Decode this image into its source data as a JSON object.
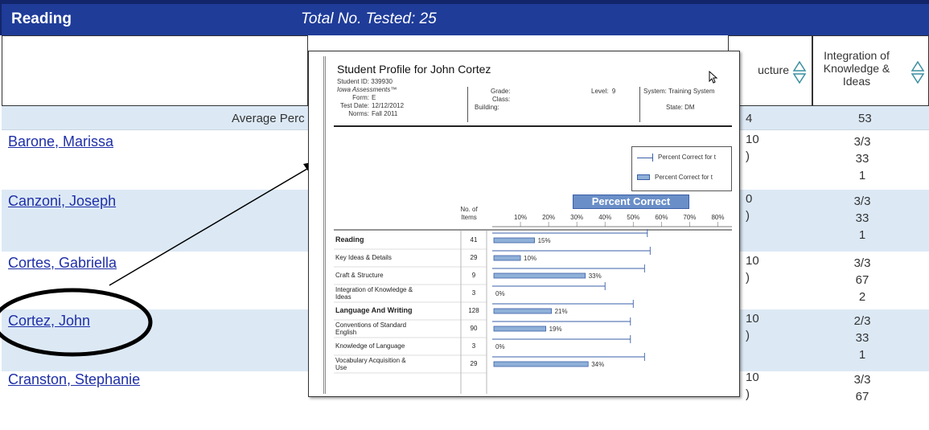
{
  "header": {
    "title": "Reading",
    "total_tested": "Total No. Tested: 25"
  },
  "columns": {
    "structure_fragment": "ucture",
    "integration": "Integration of Knowledge & Ideas"
  },
  "average_row": {
    "label": "Average Perc",
    "c3": "4",
    "c4": "53"
  },
  "students": [
    {
      "name": "Barone, Marissa",
      "frag1": "10",
      "frag2": ")",
      "c4": [
        "3/3",
        "33",
        "1"
      ]
    },
    {
      "name": "Canzoni, Joseph",
      "frag1": "0",
      "frag2": ")",
      "c4": [
        "3/3",
        "33",
        "1"
      ]
    },
    {
      "name": "Cortes, Gabriella",
      "frag1": "10",
      "frag2": ")",
      "c4": [
        "3/3",
        "67",
        "2"
      ]
    },
    {
      "name": "Cortez, John",
      "frag1": "10",
      "frag2": ")",
      "c4": [
        "2/3",
        "33",
        "1"
      ]
    },
    {
      "name": "Cranston, Stephanie",
      "frag1": "10",
      "frag2": ")",
      "c4": [
        "3/3",
        "67"
      ]
    }
  ],
  "popup": {
    "title": "Student Profile for John Cortez",
    "student_id_label": "Student ID:",
    "student_id": "339930",
    "assessment": "Iowa Assessments™",
    "form_label": "Form:",
    "form": "E",
    "test_date_label": "Test Date:",
    "test_date": "12/12/2012",
    "norms_label": "Norms:",
    "norms": "Fall 2011",
    "grade_label": "Grade:",
    "class_label": "Class:",
    "building_label": "Building:",
    "level_label": "Level:",
    "level": "9",
    "system_label": "System:",
    "system": "Training System",
    "state_label": "State:",
    "state": "DM",
    "legend_line": "Percent Correct for t",
    "legend_bar": "Percent Correct for t",
    "percent_correct_title": "Percent Correct",
    "no_of_items": "No. of Items"
  },
  "chart_data": {
    "type": "bar",
    "title": "Percent Correct",
    "x_ticks": [
      "10%",
      "20%",
      "30%",
      "40%",
      "50%",
      "60%",
      "70%",
      "80%"
    ],
    "xlim": [
      0,
      85
    ],
    "rows": [
      {
        "label": "Reading",
        "bold": true,
        "items": "41",
        "value": 15,
        "value_label": "15%",
        "ref": 55
      },
      {
        "label": "Key Ideas & Details",
        "bold": false,
        "items": "29",
        "value": 10,
        "value_label": "10%",
        "ref": 56
      },
      {
        "label": "Craft & Structure",
        "bold": false,
        "items": "9",
        "value": 33,
        "value_label": "33%",
        "ref": 54
      },
      {
        "label": "Integration of Knowledge & Ideas",
        "bold": false,
        "items": "3",
        "value": 0,
        "value_label": "0%",
        "ref": 40
      },
      {
        "label": "Language And Writing",
        "bold": true,
        "items": "128",
        "value": 21,
        "value_label": "21%",
        "ref": 50
      },
      {
        "label": "Conventions of Standard English",
        "bold": false,
        "items": "90",
        "value": 19,
        "value_label": "19%",
        "ref": 49
      },
      {
        "label": "Knowledge of Language",
        "bold": false,
        "items": "3",
        "value": 0,
        "value_label": "0%",
        "ref": 49
      },
      {
        "label": "Vocabulary Acquisition & Use",
        "bold": false,
        "items": "29",
        "value": 34,
        "value_label": "34%",
        "ref": 54
      }
    ]
  }
}
